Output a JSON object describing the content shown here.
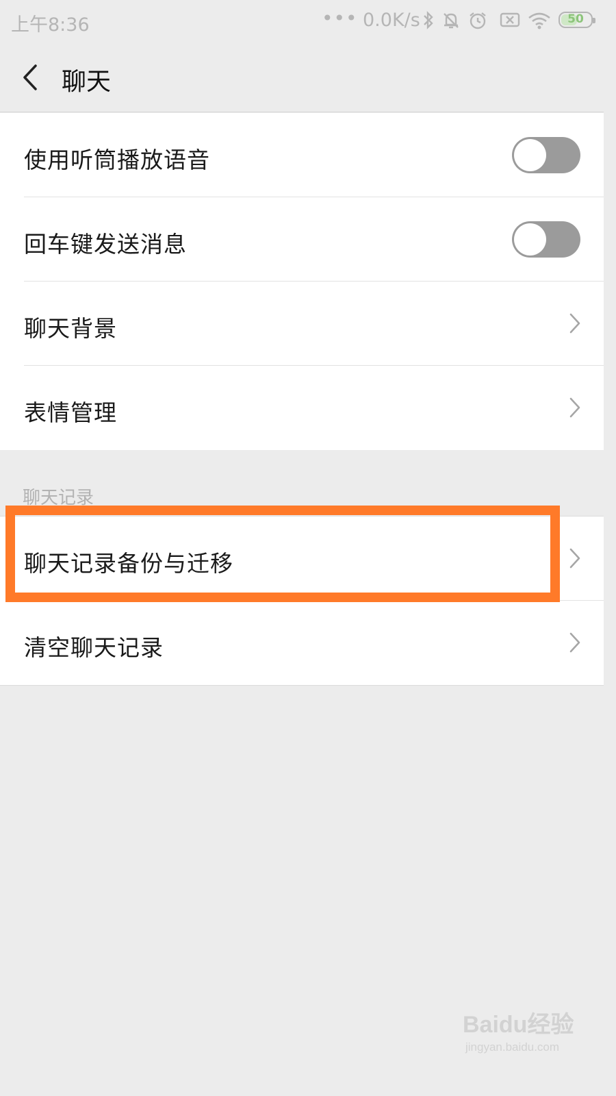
{
  "status_bar": {
    "time": "上午8:36",
    "more": "•••",
    "net_speed": "0.0K/s",
    "battery_level": "50",
    "icons": [
      "bluetooth-icon",
      "mute-bell-icon",
      "alarm-icon",
      "sim-off-icon",
      "wifi-icon",
      "battery-icon"
    ]
  },
  "header": {
    "title": "聊天"
  },
  "settings": {
    "group1": [
      {
        "label": "使用听筒播放语音",
        "control": "toggle",
        "on": false
      },
      {
        "label": "回车键发送消息",
        "control": "toggle",
        "on": false
      },
      {
        "label": "聊天背景",
        "control": "chevron"
      },
      {
        "label": "表情管理",
        "control": "chevron"
      }
    ],
    "section_title": "聊天记录",
    "group2": [
      {
        "label": "聊天记录备份与迁移",
        "control": "chevron"
      },
      {
        "label": "清空聊天记录",
        "control": "chevron"
      }
    ]
  },
  "colors": {
    "highlight": "#ff7a29",
    "toggle_off": "#9b9b9b",
    "background": "#ececec"
  },
  "watermark": {
    "main": "Baidu经验",
    "sub": "jingyan.baidu.com"
  }
}
